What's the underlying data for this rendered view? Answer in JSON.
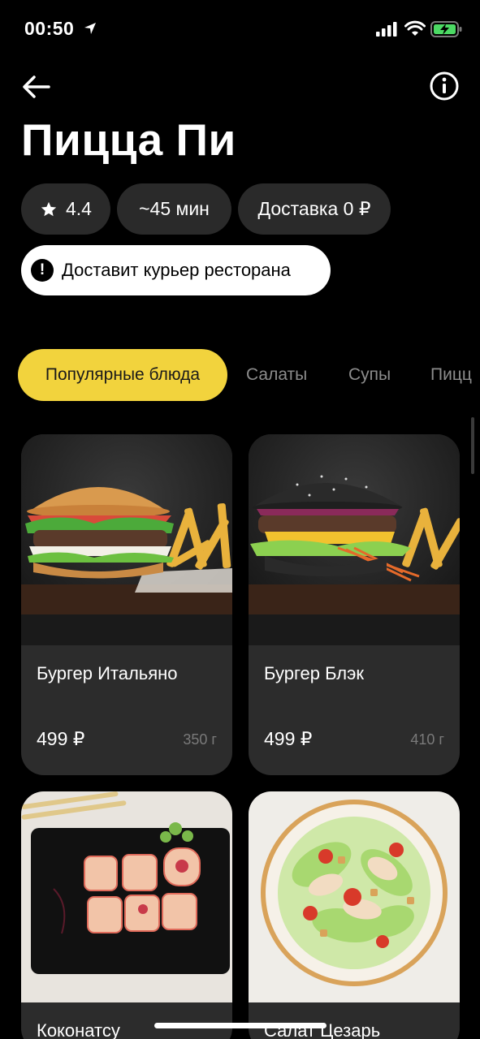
{
  "status_bar": {
    "time": "00:50"
  },
  "restaurant": {
    "name": "Пицца Пи"
  },
  "chips": {
    "rating": "4.4",
    "time": "~45 мин",
    "delivery": "Доставка 0 ₽"
  },
  "notice": {
    "icon": "!",
    "text": "Доставит курьер ресторана"
  },
  "tabs": [
    {
      "label": "Популярные блюда",
      "active": true
    },
    {
      "label": "Салаты",
      "active": false
    },
    {
      "label": "Супы",
      "active": false
    },
    {
      "label": "Пицц",
      "active": false
    }
  ],
  "products": [
    {
      "name": "Бургер Итальяно",
      "price": "499 ₽",
      "weight": "350 г"
    },
    {
      "name": "Бургер Блэк",
      "price": "499 ₽",
      "weight": "410 г"
    },
    {
      "name": "Коконатсу",
      "price": "",
      "weight": ""
    },
    {
      "name": "Салат Цезарь",
      "price": "",
      "weight": ""
    }
  ],
  "colors": {
    "accent": "#f2d33d",
    "chip_bg": "#2a2a2a",
    "card_bg": "#2c2c2c",
    "background": "#000000"
  }
}
